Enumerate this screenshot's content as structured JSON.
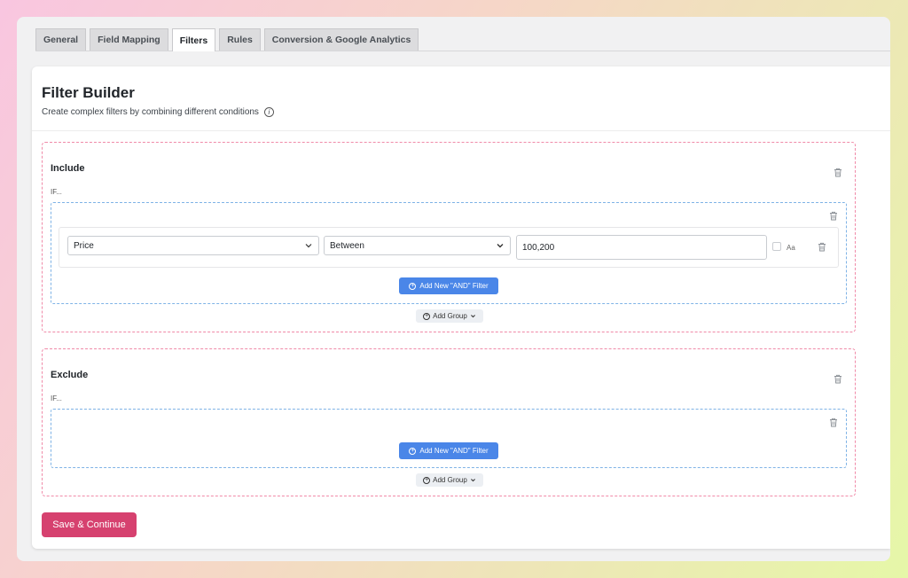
{
  "tabs": [
    {
      "label": "General"
    },
    {
      "label": "Field Mapping"
    },
    {
      "label": "Filters"
    },
    {
      "label": "Rules"
    },
    {
      "label": "Conversion & Google Analytics"
    }
  ],
  "header": {
    "title": "Filter Builder",
    "subtitle": "Create complex filters by combining different conditions",
    "info_icon": "i"
  },
  "include": {
    "title": "Include",
    "if_label": "IF...",
    "row": {
      "field": "Price",
      "operator": "Between",
      "value": "100,200",
      "case_label": "Aa"
    },
    "add_and_label": "Add New \"AND\" Filter",
    "add_group_label": "Add Group"
  },
  "exclude": {
    "title": "Exclude",
    "if_label": "IF...",
    "add_and_label": "Add New \"AND\" Filter",
    "add_group_label": "Add Group"
  },
  "save_label": "Save & Continue",
  "colors": {
    "primary": "#4a86e8",
    "save": "#d6416f",
    "include_border": "#f08aa8",
    "group_border": "#7fb3e6"
  }
}
